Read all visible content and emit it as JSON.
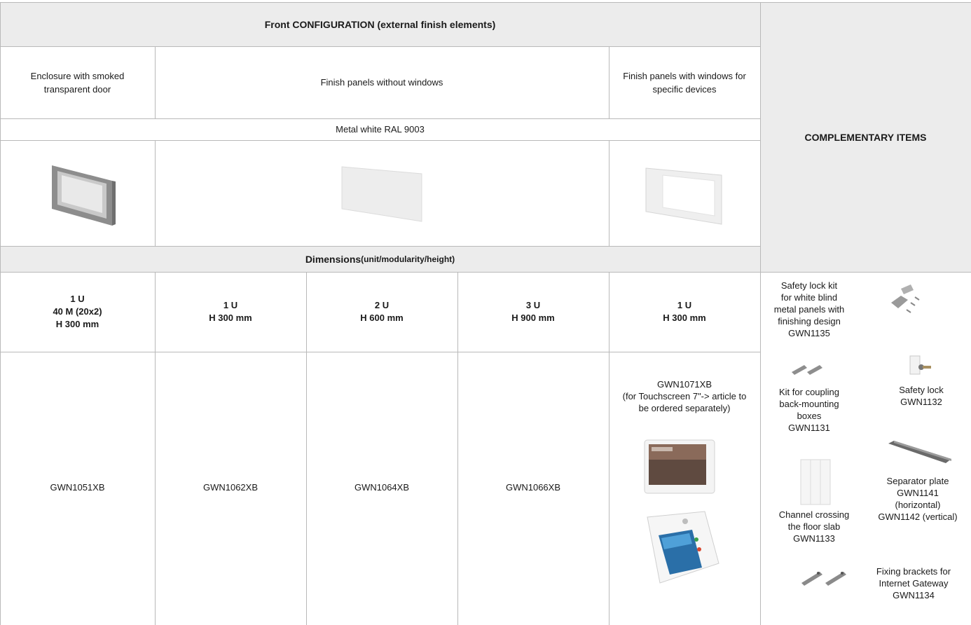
{
  "header": {
    "title": "Front CONFIGURATION (external finish elements)",
    "complementary": "COMPLEMENTARY ITEMS"
  },
  "categories": {
    "enclosure": "Enclosure with smoked\ntransparent door",
    "without_windows": "Finish panels without windows",
    "with_windows": "Finish panels with windows for\nspecific devices"
  },
  "finish": "Metal white RAL 9003",
  "dimensions": {
    "title": "Dimensions",
    "subtitle": " (unit/modularity/height)"
  },
  "columns": [
    {
      "heading": "1 U\n40 M (20x2)\nH 300 mm",
      "code": "GWN1051XB"
    },
    {
      "heading": "1 U\nH 300 mm",
      "code": "GWN1062XB"
    },
    {
      "heading": "2 U\nH 600 mm",
      "code": "GWN1064XB"
    },
    {
      "heading": "3 U\nH 900 mm",
      "code": "GWN1066XB"
    },
    {
      "heading": "1 U\nH 300 mm",
      "code": "GWN1071XB\n(for Touchscreen 7\"-> article to\nbe ordered separately)"
    }
  ],
  "items": [
    {
      "label": "Safety lock kit\nfor white blind\nmetal panels with\nfinishing design\nGWN1135",
      "icon": "screws-icon"
    },
    {
      "label": "Safety lock\nGWN1132",
      "icon": "key-lock-icon"
    },
    {
      "label": "Kit for coupling\nback-mounting\nboxes\nGWN1131",
      "icon": "coupling-bars-icon"
    },
    {
      "label": "Separator plate\nGWN1141\n(horizontal)\nGWN1142 (vertical)",
      "icon": "separator-plate-icon"
    },
    {
      "label": "Channel crossing\nthe floor slab\nGWN1133",
      "icon": "channel-crossing-icon"
    },
    {
      "label": "Fixing brackets for\nInternet Gateway\nGWN1134",
      "icon": "fixing-brackets-icon"
    }
  ]
}
